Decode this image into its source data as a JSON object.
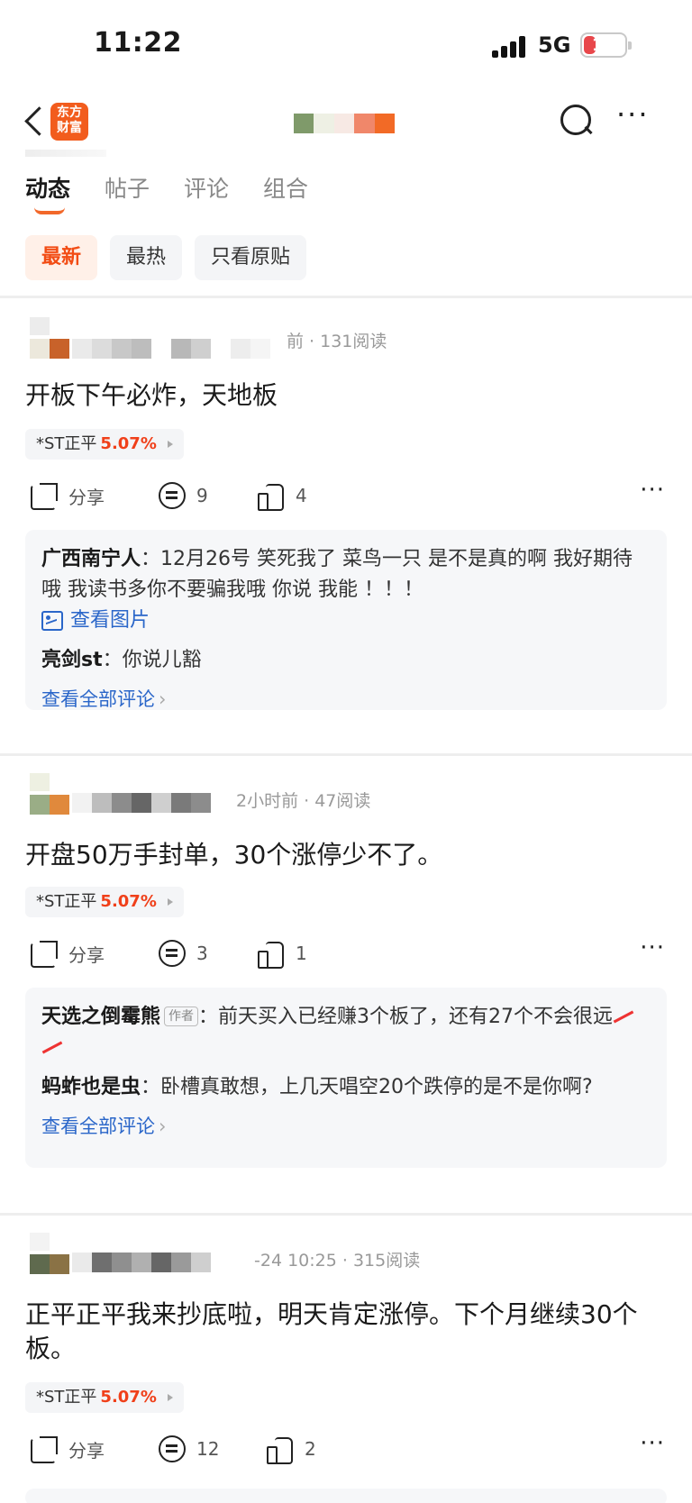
{
  "status_bar": {
    "time": "11:22",
    "network": "5G",
    "battery": "14"
  },
  "header": {
    "logo_text": "东方\n财富"
  },
  "tabs": [
    {
      "label": "动态",
      "active": true
    },
    {
      "label": "帖子",
      "active": false
    },
    {
      "label": "评论",
      "active": false
    },
    {
      "label": "组合",
      "active": false
    }
  ],
  "filters": [
    {
      "label": "最新",
      "active": true
    },
    {
      "label": "最热",
      "active": false
    },
    {
      "label": "只看原贴",
      "active": false
    }
  ],
  "posts": [
    {
      "meta": "前 · 131阅读",
      "content": "开板下午必炸，天地板",
      "stock_name": "*ST正平",
      "stock_change": "5.07%",
      "share_label": "分享",
      "comments": "9",
      "likes": "4",
      "replies": [
        {
          "user": "广西南宁人",
          "text": "12月26号  笑死我了  菜鸟一只  是不是真的啊  我好期待哦  我读书多你不要骗我哦  你说  我能  ！！！"
        },
        {
          "user": "亮剑st",
          "text": "你说儿豁"
        }
      ],
      "view_image": "查看图片",
      "view_all": "查看全部评论"
    },
    {
      "meta": "2小时前 · 47阅读",
      "content": "开盘50万手封单，30个涨停少不了。",
      "stock_name": "*ST正平",
      "stock_change": "5.07%",
      "share_label": "分享",
      "comments": "3",
      "likes": "1",
      "replies": [
        {
          "user": "天选之倒霉熊",
          "tag": "作者",
          "text": "前天买入已经赚3个板了，还有27个不会很远"
        },
        {
          "user": "蚂蚱也是虫",
          "text": "卧槽真敢想，上几天唱空20个跌停的是不是你啊?"
        }
      ],
      "view_all": "查看全部评论"
    },
    {
      "meta": "-24 10:25 · 315阅读",
      "content": "正平正平我来抄底啦，明天肯定涨停。下个月继续30个板。",
      "stock_name": "*ST正平",
      "stock_change": "5.07%",
      "share_label": "分享",
      "comments": "12",
      "likes": "2"
    }
  ],
  "colors": {
    "accent": "#f24c14",
    "link": "#2a66c9",
    "up": "#f0401a"
  }
}
